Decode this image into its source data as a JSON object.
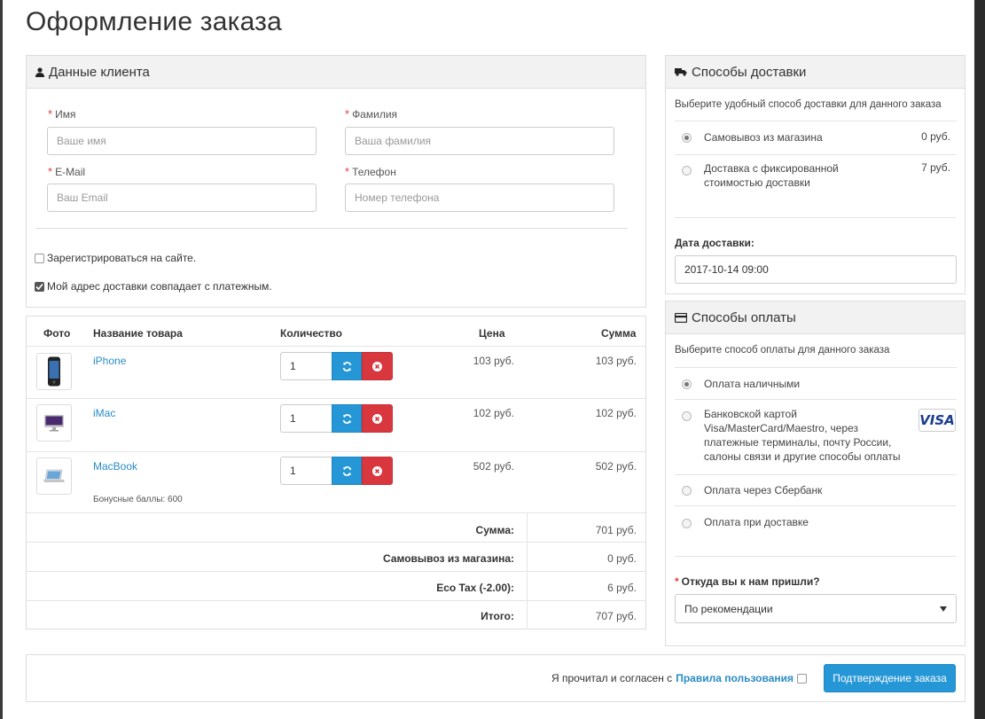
{
  "page_title": "Оформление заказа",
  "customer": {
    "heading": "Данные клиента",
    "fields": {
      "first_name": {
        "label": "Имя",
        "placeholder": "Ваше имя"
      },
      "last_name": {
        "label": "Фамилия",
        "placeholder": "Ваша фамилия"
      },
      "email": {
        "label": "E-Mail",
        "placeholder": "Ваш Email"
      },
      "phone": {
        "label": "Телефон",
        "placeholder": "Номер телефона"
      }
    },
    "register_label": "Зарегистрироваться на сайте.",
    "register_checked": false,
    "same_address_label": "Мой адрес доставки совпадает с платежным.",
    "same_address_checked": true
  },
  "cart": {
    "headers": {
      "photo": "Фото",
      "name": "Название товара",
      "qty": "Количество",
      "price": "Цена",
      "total": "Сумма"
    },
    "items": [
      {
        "name": "iPhone",
        "qty": "1",
        "price": "103 руб.",
        "total": "103 руб.",
        "icon": "iphone-icon"
      },
      {
        "name": "iMac",
        "qty": "1",
        "price": "102 руб.",
        "total": "102 руб.",
        "icon": "imac-icon"
      },
      {
        "name": "MacBook",
        "qty": "1",
        "price": "502 руб.",
        "total": "502 руб.",
        "icon": "macbook-icon",
        "bonus": "Бонусные баллы: 600"
      }
    ],
    "totals": [
      {
        "label": "Сумма:",
        "value": "701 руб."
      },
      {
        "label": "Самовывоз из магазина:",
        "value": "0 руб."
      },
      {
        "label": "Eco Tax (-2.00):",
        "value": "6 руб."
      },
      {
        "label": "Итого:",
        "value": "707 руб."
      }
    ]
  },
  "shipping": {
    "heading": "Способы доставки",
    "intro": "Выберите удобный способ доставки для данного заказа",
    "options": [
      {
        "label": "Самовывоз из магазина",
        "price": "0 руб.",
        "selected": true
      },
      {
        "label_line1": "Доставка с фиксированной",
        "label_line2": "стоимостью доставки",
        "price": "7 руб.",
        "selected": false
      }
    ],
    "date_label": "Дата доставки:",
    "date_value": "2017-10-14 09:00"
  },
  "payment": {
    "heading": "Способы оплаты",
    "intro": "Выберите способ оплаты для данного заказа",
    "options": [
      {
        "lines": [
          "Оплата наличными"
        ],
        "selected": true
      },
      {
        "lines": [
          "Банковской картой",
          "Visa/MasterCard/Maestro, через",
          "платежные терминалы, почту России,",
          "салоны связи и другие способы оплаты"
        ],
        "selected": false,
        "badge": "VISA"
      },
      {
        "lines": [
          "Оплата через Сбербанк"
        ],
        "selected": false
      },
      {
        "lines": [
          "Оплата при доставке"
        ],
        "selected": false
      }
    ],
    "referral_label": "Откуда вы к нам пришли?",
    "referral_value": "По рекомендации"
  },
  "confirm": {
    "agree_text": "Я прочитал и согласен с",
    "agree_link": "Правила пользования",
    "agree_checked": false,
    "button": "Подтверждение заказа"
  },
  "colors": {
    "accent": "#2697d6",
    "danger": "#d9373e",
    "required": "#e2413b",
    "link": "#2a8bc5"
  }
}
